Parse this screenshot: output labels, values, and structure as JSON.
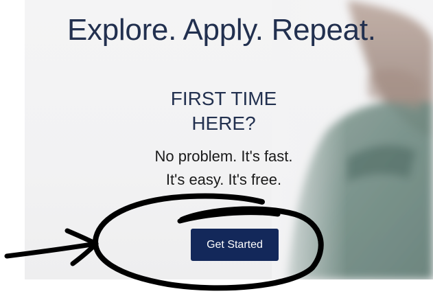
{
  "hero": {
    "title": "Explore. Apply. Repeat.",
    "first_time_line1": "FIRST TIME",
    "first_time_line2": "HERE?",
    "tagline_line1": "No problem. It's fast.",
    "tagline_line2": "It's easy. It's free.",
    "cta_label": "Get Started"
  },
  "colors": {
    "heading": "#22304f",
    "button_bg": "#13285a",
    "button_text": "#ffffff",
    "panel_bg": "#f4f4f5",
    "annotation_ink": "#000000"
  },
  "decorations": {
    "background_image": "person-photo",
    "annotations": [
      "hand-drawn-circle",
      "hand-drawn-arrow"
    ]
  }
}
